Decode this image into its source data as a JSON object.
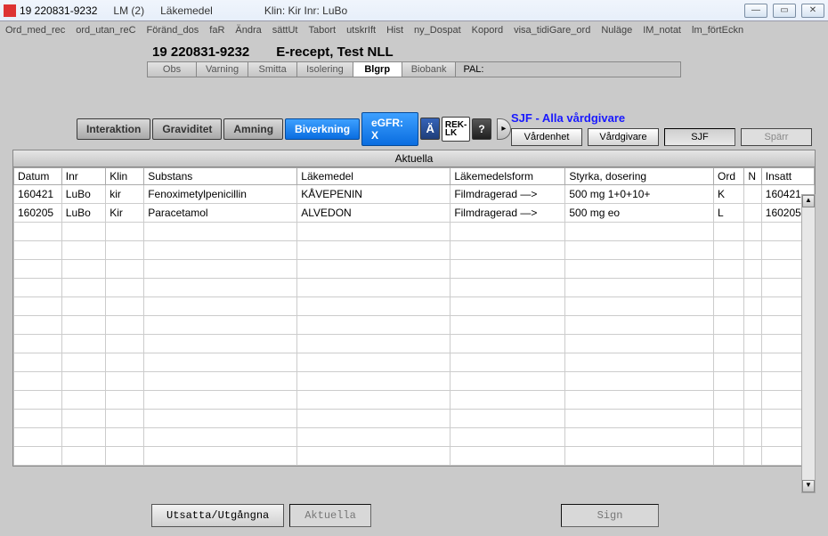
{
  "title": {
    "patient_id": "19 220831-9232",
    "lm": "LM (2)",
    "module": "Läkemedel",
    "klin_inr": "Klin: Kir  Inr: LuBo"
  },
  "menu": [
    "Ord_med_rec",
    "ord_utan_reC",
    "Föränd_dos",
    "faR",
    "Ändra",
    "sättUt",
    "Tabort",
    "utskrIft",
    "Hist",
    "ny_Dospat",
    "Kopord",
    "visa_tidiGare_ord",
    "Nuläge",
    "IM_notat",
    "lm_förtEckn"
  ],
  "patient": {
    "id": "19 220831-9232",
    "name": "E-recept, Test NLL",
    "strip": [
      "Obs",
      "Varning",
      "Smitta",
      "Isolering",
      "Blgrp",
      "Biobank"
    ],
    "strip_active_index": 4,
    "pal": "PAL:"
  },
  "pills": {
    "interaktion": "Interaktion",
    "graviditet": "Graviditet",
    "amning": "Amning",
    "biverkning": "Biverkning",
    "egfr": "eGFR: X",
    "a_umlaut": "Ä",
    "rek": "REK-\nLK",
    "help": "?"
  },
  "right": {
    "title": "SJF - Alla vårdgivare",
    "vardenhet": "Vårdenhet",
    "vardgivare": "Vårdgivare",
    "sjf": "SJF",
    "sparr": "Spärr"
  },
  "table": {
    "title": "Aktuella",
    "headers": [
      "Datum",
      "Inr",
      "Klin",
      "Substans",
      "Läkemedel",
      "Läkemedelsform",
      "Styrka, dosering",
      "Ord",
      "N",
      "Insatt"
    ],
    "rows": [
      {
        "datum": "160421",
        "inr": "LuBo",
        "klin": "kir",
        "substans": "Fenoximetylpenicillin",
        "lakemedel": "KÅVEPENIN",
        "form": "Filmdragerad —>",
        "styrka": "500 mg 1+0+10+",
        "ord": "K",
        "n": "",
        "insatt": "160421"
      },
      {
        "datum": "160205",
        "inr": "LuBo",
        "klin": "Kir",
        "substans": "Paracetamol",
        "lakemedel": "ALVEDON",
        "form": "Filmdragerad —>",
        "styrka": "500 mg eo",
        "ord": "L",
        "n": "",
        "insatt": "160205"
      }
    ]
  },
  "bottom": {
    "utsatta": "Utsatta/Utgångna",
    "aktuella": "Aktuella",
    "sign": "Sign"
  }
}
